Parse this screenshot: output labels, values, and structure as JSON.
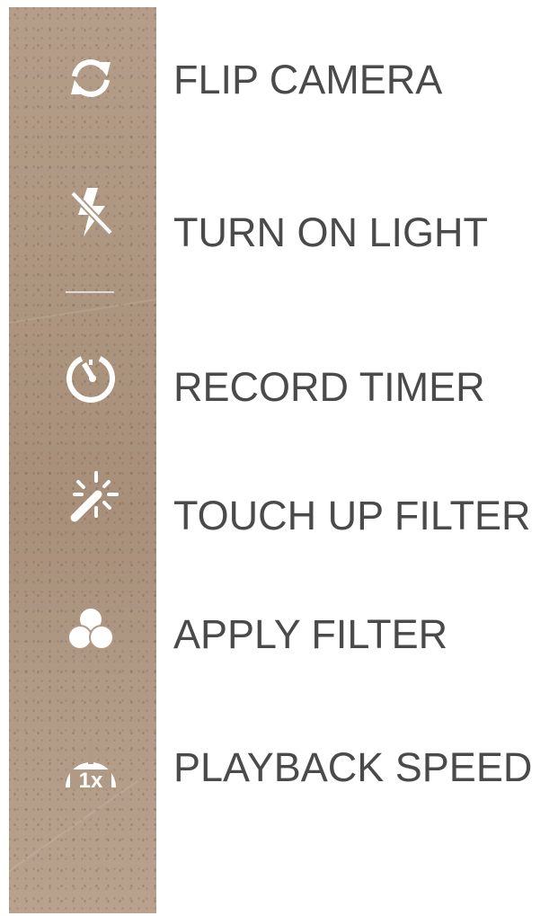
{
  "menu": {
    "items": [
      {
        "id": "flip-camera",
        "icon": "flip-camera-icon",
        "label": "FLIP CAMERA"
      },
      {
        "id": "light",
        "icon": "flash-off-icon",
        "label": "TURN ON LIGHT"
      },
      {
        "id": "timer",
        "icon": "timer-icon",
        "label": "RECORD TIMER"
      },
      {
        "id": "touch-up",
        "icon": "magic-wand-icon",
        "label": "TOUCH UP FILTER"
      },
      {
        "id": "filter",
        "icon": "filter-circles-icon",
        "label": "APPLY FILTER"
      },
      {
        "id": "speed",
        "icon": "speedometer-icon",
        "label": "PLAYBACK SPEED",
        "icon_text": "1x"
      }
    ]
  },
  "colors": {
    "label_text": "#4a4a4a",
    "icon": "#ffffff",
    "background_strip": "#b19a85"
  }
}
